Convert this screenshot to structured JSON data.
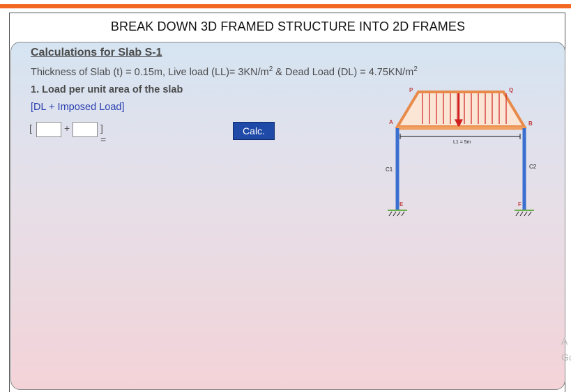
{
  "page": {
    "title": "BREAK DOWN 3D FRAMED STRUCTURE INTO 2D FRAMES"
  },
  "calc": {
    "heading": "Calculations for Slab S-1",
    "thickness_prefix": "Thickness of Slab (t) = 0.15m, Live load (LL)= 3KN/m",
    "thickness_mid": " & Dead Load (DL) = 4.75KN/m",
    "superscript": "2",
    "load_heading": "1. Load per unit area of the slab",
    "formula": "[DL + Imposed Load]",
    "open_bracket": "[",
    "plus": "+",
    "close_eq": "] =",
    "dl_value": "",
    "imposed_value": "",
    "button_label": "Calc."
  },
  "diagram": {
    "labels": {
      "A": "A",
      "B": "B",
      "P": "P",
      "Q": "Q",
      "E": "E",
      "F": "F",
      "C1": "C1",
      "C2": "C2",
      "span": "L1 = 5m"
    },
    "colors": {
      "beam": "#f0a060",
      "load_outline": "#e88a4a",
      "column": "#3a6fd0",
      "load_arrow": "#d02020",
      "support": "#6ab04c"
    }
  },
  "edge": {
    "text1": "A",
    "text2": "Go"
  }
}
